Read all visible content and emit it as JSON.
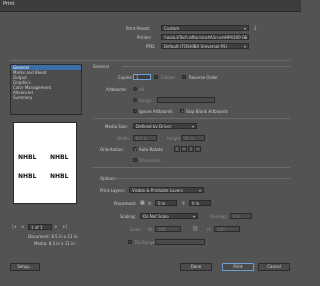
{
  "window": {
    "title": "Print"
  },
  "header": {
    "print_preset_label": "Print Preset:",
    "print_preset_value": "Custom",
    "printer_label": "Printer:",
    "printer_value": "\\\\gaia.kTech.gfhp.local\\A1n.se\\HP4100 CS",
    "ppd_label": "PPD:",
    "ppd_value": "Default (TOSHIBA Universal PS)"
  },
  "sidebar": {
    "items": [
      {
        "label": "General"
      },
      {
        "label": "Marks and Bleed"
      },
      {
        "label": "Output"
      },
      {
        "label": "Graphics"
      },
      {
        "label": "Color Management"
      },
      {
        "label": "Advanced"
      },
      {
        "label": "Summary"
      }
    ]
  },
  "preview": {
    "logo_text": "NHBL",
    "page_field": "1 of 1",
    "document_info": "Document: 8.5 in x 11 in",
    "media_info": "Media: 8.5 in x 11 in"
  },
  "general": {
    "section_title": "General",
    "copies_label": "Copies:",
    "copies_value": "1",
    "collate_label": "Collate",
    "reverse_order_label": "Reverse Order",
    "artboards_label": "Artboards:",
    "all_label": "All",
    "range_label": "Range:",
    "ignore_artboards_label": "Ignore Artboards",
    "skip_blank_label": "Skip Blank Artboards"
  },
  "media": {
    "media_size_label": "Media Size:",
    "media_size_value": "Defined by Driver",
    "width_label": "Width:",
    "width_value": "8.5 in",
    "height_label": "Height:",
    "height_value": "11 in",
    "orientation_label": "Orientation:",
    "auto_rotate_label": "Auto-Rotate",
    "transverse_label": "Transverse"
  },
  "options": {
    "section_title": "Options",
    "print_layers_label": "Print Layers:",
    "print_layers_value": "Visible & Printable Layers",
    "placement_label": "Placement:",
    "x_label": "X:",
    "x_value": "0 in",
    "y_label": "Y:",
    "y_value": "0 in",
    "scaling_label": "Scaling:",
    "scaling_value": "Do Not Scale",
    "overlap_label": "Overlap:",
    "overlap_value": "0 in",
    "scale_label": "Scale:",
    "w_label": "W:",
    "w_value": "100",
    "h_label": "H:",
    "h_value": "100",
    "tile_range_label": "Tile Range:"
  },
  "footer": {
    "setup_label": "Setup...",
    "done_label": "Done",
    "print_label": "Print",
    "cancel_label": "Cancel"
  },
  "colors": {
    "selection": "#3a6ea5",
    "background": "#535353"
  }
}
